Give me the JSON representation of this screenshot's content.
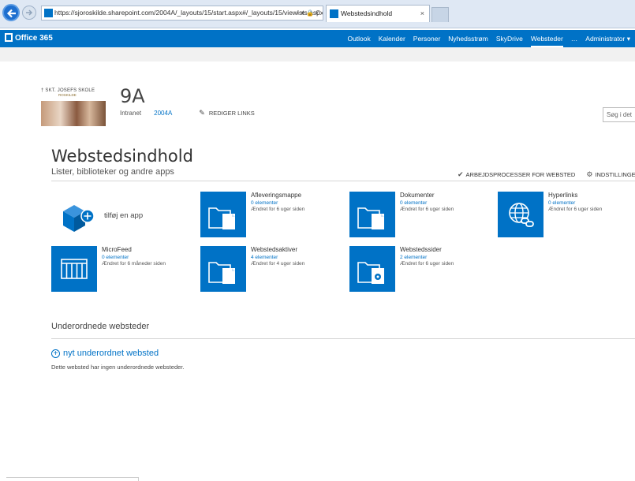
{
  "browser": {
    "url": "https://sjoroskilde.sharepoint.com/2004A/_layouts/15/start.aspx#/_layouts/15/viewlsts.aspx",
    "address_controls": "⌕ ▾ 🔒 C",
    "tab_title": "Webstedsindhold",
    "tab_close": "×"
  },
  "suitebar": {
    "brand": "Office 365",
    "nav": [
      "Outlook",
      "Kalender",
      "Personer",
      "Nyhedsstrøm",
      "SkyDrive",
      "Websteder",
      "…",
      "Administrator ▾"
    ],
    "active": "Websteder"
  },
  "site": {
    "logo_school": "† SKT. JOSEFS SKOLE",
    "logo_city": "ROSKILDE",
    "title": "9A",
    "nav_intranet": "Intranet",
    "nav_current": "2004A",
    "edit_links": "REDIGER LINKS",
    "search_placeholder": "Søg i det"
  },
  "page": {
    "title": "Webstedsindhold",
    "subtitle": "Lister, biblioteker og andre apps",
    "action_workflows": "ARBEJDSPROCESSER FOR WEBSTED",
    "action_settings": "INDSTILLINGER",
    "add_app": "tilføj en app"
  },
  "tiles": [
    {
      "name": "Afleveringsmappe",
      "count": "0 elementer",
      "modified": "Ændret for 6 uger siden",
      "icon": "folder-doc-icon"
    },
    {
      "name": "Dokumenter",
      "count": "0 elementer",
      "modified": "Ændret for 6 uger siden",
      "icon": "folder-doc-icon"
    },
    {
      "name": "Hyperlinks",
      "count": "0 elementer",
      "modified": "Ændret for 6 uger siden",
      "icon": "globe-link-icon"
    },
    {
      "name": "MicroFeed",
      "count": "0 elementer",
      "modified": "Ændret for 6 måneder siden",
      "icon": "list-columns-icon"
    },
    {
      "name": "Webstedsaktiver",
      "count": "4 elementer",
      "modified": "Ændret for 4 uger siden",
      "icon": "folder-doc-icon"
    },
    {
      "name": "Webstedssider",
      "count": "2 elementer",
      "modified": "Ændret for 6 uger siden",
      "icon": "folder-page-icon"
    }
  ],
  "subsites": {
    "heading": "Underordnede websteder",
    "new_link": "nyt underordnet websted",
    "plus": "+",
    "empty": "Dette websted har ingen underordnede websteder."
  },
  "colors": {
    "accent": "#0072c6",
    "tile": "#0072c6",
    "browser_chrome": "#dfe8f4"
  }
}
